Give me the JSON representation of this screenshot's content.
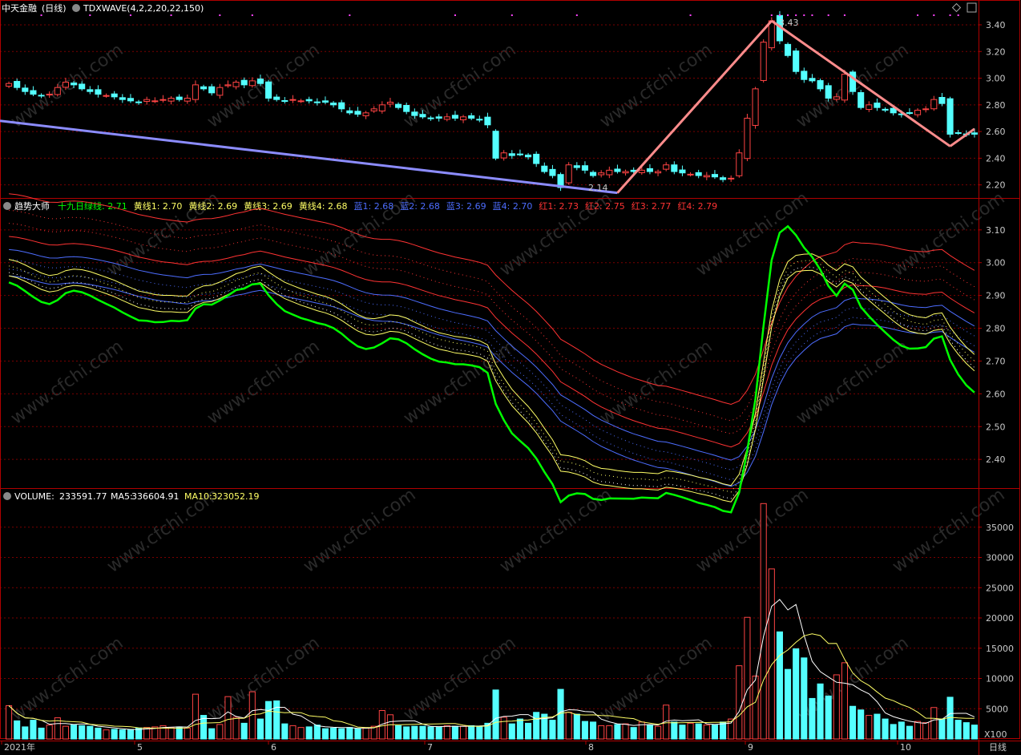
{
  "panels": {
    "price": {
      "header": {
        "name": "中天金融",
        "period": "(日线)",
        "indicator": "TDXWAVE(4,2,2,20,22,150)"
      },
      "y_ticks": [
        "3.40",
        "3.20",
        "3.00",
        "2.80",
        "2.60",
        "2.40",
        "2.20"
      ],
      "annotations": {
        "high": "3.43",
        "low": "2.14"
      }
    },
    "trend": {
      "header": {
        "name": "趋势大师",
        "items": [
          {
            "label": "十九日绿线:",
            "value": "2.71",
            "color": "#00ff00"
          },
          {
            "label": "黄线1:",
            "value": "2.70",
            "color": "#ffff66"
          },
          {
            "label": "黄线2:",
            "value": "2.69",
            "color": "#ffff66"
          },
          {
            "label": "黄线3:",
            "value": "2.69",
            "color": "#ffff66"
          },
          {
            "label": "黄线4:",
            "value": "2.68",
            "color": "#ffff66"
          },
          {
            "label": "蓝1:",
            "value": "2.68",
            "color": "#4d6dff"
          },
          {
            "label": "蓝2:",
            "value": "2.68",
            "color": "#4d6dff"
          },
          {
            "label": "蓝3:",
            "value": "2.69",
            "color": "#4d6dff"
          },
          {
            "label": "蓝4:",
            "value": "2.70",
            "color": "#4d6dff"
          },
          {
            "label": "红1:",
            "value": "2.73",
            "color": "#ff3333"
          },
          {
            "label": "红2:",
            "value": "2.75",
            "color": "#ff3333"
          },
          {
            "label": "红3:",
            "value": "2.77",
            "color": "#ff3333"
          },
          {
            "label": "红4:",
            "value": "2.79",
            "color": "#ff3333"
          }
        ]
      },
      "y_ticks": [
        "3.10",
        "3.00",
        "2.90",
        "2.80",
        "2.70",
        "2.60",
        "2.50",
        "2.40"
      ]
    },
    "volume": {
      "header": {
        "label": "VOLUME:",
        "value": "233591.77",
        "ma5_label": "MA5:",
        "ma5": "336604.91",
        "ma10_label": "MA10:",
        "ma10": "323052.19"
      },
      "y_ticks": [
        "35000",
        "30000",
        "25000",
        "20000",
        "15000",
        "10000",
        "5000"
      ],
      "unit": "X100"
    }
  },
  "x_axis": {
    "labels": [
      "2021年",
      "5",
      "6",
      "7",
      "8",
      "9",
      "10"
    ],
    "period_label": "日线"
  },
  "watermark": "www.cfchi.com",
  "colors": {
    "up": "#ff4444",
    "down": "#54ffff",
    "grid": "#7a0000",
    "frame": "#b00000",
    "wave_up": "#ff8c8c",
    "wave_down": "#8c8cff"
  },
  "chart_data": {
    "type": "candlestick",
    "title": "中天金融 (日线)",
    "price": {
      "ylim": [
        2.12,
        3.52
      ],
      "high_marker": 3.43,
      "low_marker": 2.14,
      "close": [
        2.96,
        2.93,
        2.9,
        2.88,
        2.87,
        2.88,
        2.93,
        2.97,
        2.95,
        2.92,
        2.9,
        2.88,
        2.87,
        2.86,
        2.84,
        2.83,
        2.82,
        2.84,
        2.83,
        2.84,
        2.85,
        2.84,
        2.85,
        2.95,
        2.92,
        2.89,
        2.93,
        2.95,
        2.97,
        2.95,
        2.98,
        2.96,
        2.85,
        2.84,
        2.83,
        2.84,
        2.83,
        2.83,
        2.82,
        2.82,
        2.8,
        2.77,
        2.74,
        2.73,
        2.74,
        2.77,
        2.8,
        2.82,
        2.78,
        2.75,
        2.72,
        2.71,
        2.7,
        2.7,
        2.71,
        2.7,
        2.71,
        2.7,
        2.69,
        2.65,
        2.4,
        2.44,
        2.42,
        2.43,
        2.41,
        2.36,
        2.3,
        2.27,
        2.18,
        2.35,
        2.33,
        2.31,
        2.27,
        2.29,
        2.31,
        2.3,
        2.3,
        2.3,
        2.31,
        2.3,
        2.3,
        2.35,
        2.3,
        2.29,
        2.28,
        2.27,
        2.27,
        2.26,
        2.24,
        2.25,
        2.44,
        2.7,
        2.92,
        3.27,
        3.43,
        3.28,
        3.17,
        3.05,
        2.99,
        2.98,
        2.92,
        2.85,
        2.86,
        3.03,
        2.9,
        2.78,
        2.8,
        2.78,
        2.76,
        2.74,
        2.73,
        2.74,
        2.76,
        2.77,
        2.84,
        2.81,
        2.58,
        2.59,
        2.58,
        2.58
      ],
      "wave_segments": [
        [
          2.68,
          2.14
        ],
        [
          2.14,
          3.43
        ],
        [
          3.43,
          2.49
        ],
        [
          2.49,
          2.62
        ]
      ]
    },
    "trend_lines": {
      "ylim": [
        2.31,
        3.19
      ],
      "series": [
        {
          "name": "十九日绿线",
          "last": 2.71
        },
        {
          "name": "黄线1",
          "last": 2.7
        },
        {
          "name": "黄线4",
          "last": 2.68
        },
        {
          "name": "蓝1",
          "last": 2.68
        },
        {
          "name": "蓝4",
          "last": 2.7
        },
        {
          "name": "红1",
          "last": 2.73
        },
        {
          "name": "红4",
          "last": 2.79
        }
      ]
    },
    "volume": {
      "ylim": [
        0,
        40000
      ],
      "values": [
        5500,
        3000,
        2000,
        3100,
        1800,
        2300,
        3500,
        2100,
        2300,
        2200,
        2100,
        1800,
        1500,
        1600,
        1500,
        1500,
        1800,
        1900,
        2000,
        2200,
        1900,
        2000,
        1800,
        7400,
        3900,
        1700,
        2400,
        7000,
        3600,
        2600,
        7800,
        3300,
        6200,
        6300,
        2500,
        2200,
        1900,
        2000,
        2300,
        1700,
        1800,
        1700,
        1900,
        1700,
        1800,
        2100,
        4700,
        4000,
        2200,
        2000,
        2100,
        2100,
        2000,
        2000,
        2200,
        2100,
        2100,
        2200,
        2100,
        2600,
        8100,
        3600,
        2500,
        3300,
        2600,
        4400,
        4100,
        3100,
        8200,
        4400,
        4100,
        2900,
        2800,
        2200,
        2200,
        2400,
        2500,
        1900,
        2800,
        2300,
        2100,
        5600,
        2800,
        2300,
        2600,
        2500,
        2300,
        2300,
        2800,
        3300,
        12100,
        20100,
        10400,
        38900,
        28100,
        17700,
        11500,
        14900,
        13400,
        6700,
        9100,
        7100,
        10600,
        12600,
        5400,
        4800,
        3900,
        4100,
        3300,
        2400,
        2800,
        2100,
        2900,
        2700,
        5200,
        3300,
        6900,
        3100,
        2700,
        2300
      ],
      "ma5": 336604.91,
      "ma10": 323052.19
    },
    "x_month_labels": [
      "2021年",
      "5",
      "6",
      "7",
      "8",
      "9",
      "10"
    ]
  }
}
